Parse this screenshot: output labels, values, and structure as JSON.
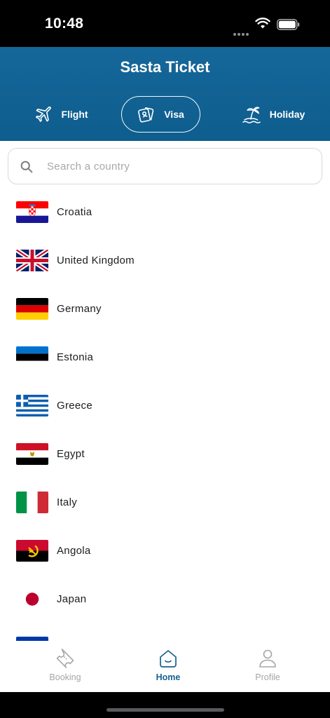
{
  "status_bar": {
    "time": "10:48"
  },
  "header": {
    "title": "Sasta Ticket",
    "tabs": [
      {
        "label": "Flight",
        "icon": "airplane-icon"
      },
      {
        "label": "Visa",
        "icon": "passport-icon",
        "selected": true
      },
      {
        "label": "Holiday",
        "icon": "palm-island-icon"
      }
    ]
  },
  "search": {
    "placeholder": "Search a country",
    "value": ""
  },
  "countries": [
    {
      "name": "Croatia",
      "flag": "croatia-flag-icon"
    },
    {
      "name": "United Kingdom",
      "flag": "united-kingdom-flag-icon"
    },
    {
      "name": "Germany",
      "flag": "germany-flag-icon"
    },
    {
      "name": "Estonia",
      "flag": "estonia-flag-icon"
    },
    {
      "name": "Greece",
      "flag": "greece-flag-icon"
    },
    {
      "name": "Egypt",
      "flag": "egypt-flag-icon"
    },
    {
      "name": "Italy",
      "flag": "italy-flag-icon"
    },
    {
      "name": "Angola",
      "flag": "angola-flag-icon"
    },
    {
      "name": "Japan",
      "flag": "japan-flag-icon"
    }
  ],
  "bottom_nav": {
    "items": [
      {
        "label": "Booking",
        "icon": "ticket-icon"
      },
      {
        "label": "Home",
        "icon": "home-icon",
        "active": true
      },
      {
        "label": "Profile",
        "icon": "person-icon"
      }
    ]
  },
  "colors": {
    "brand": "#0e5d8e",
    "active_nav": "#16628f",
    "inactive_nav": "#a5a5aa"
  }
}
